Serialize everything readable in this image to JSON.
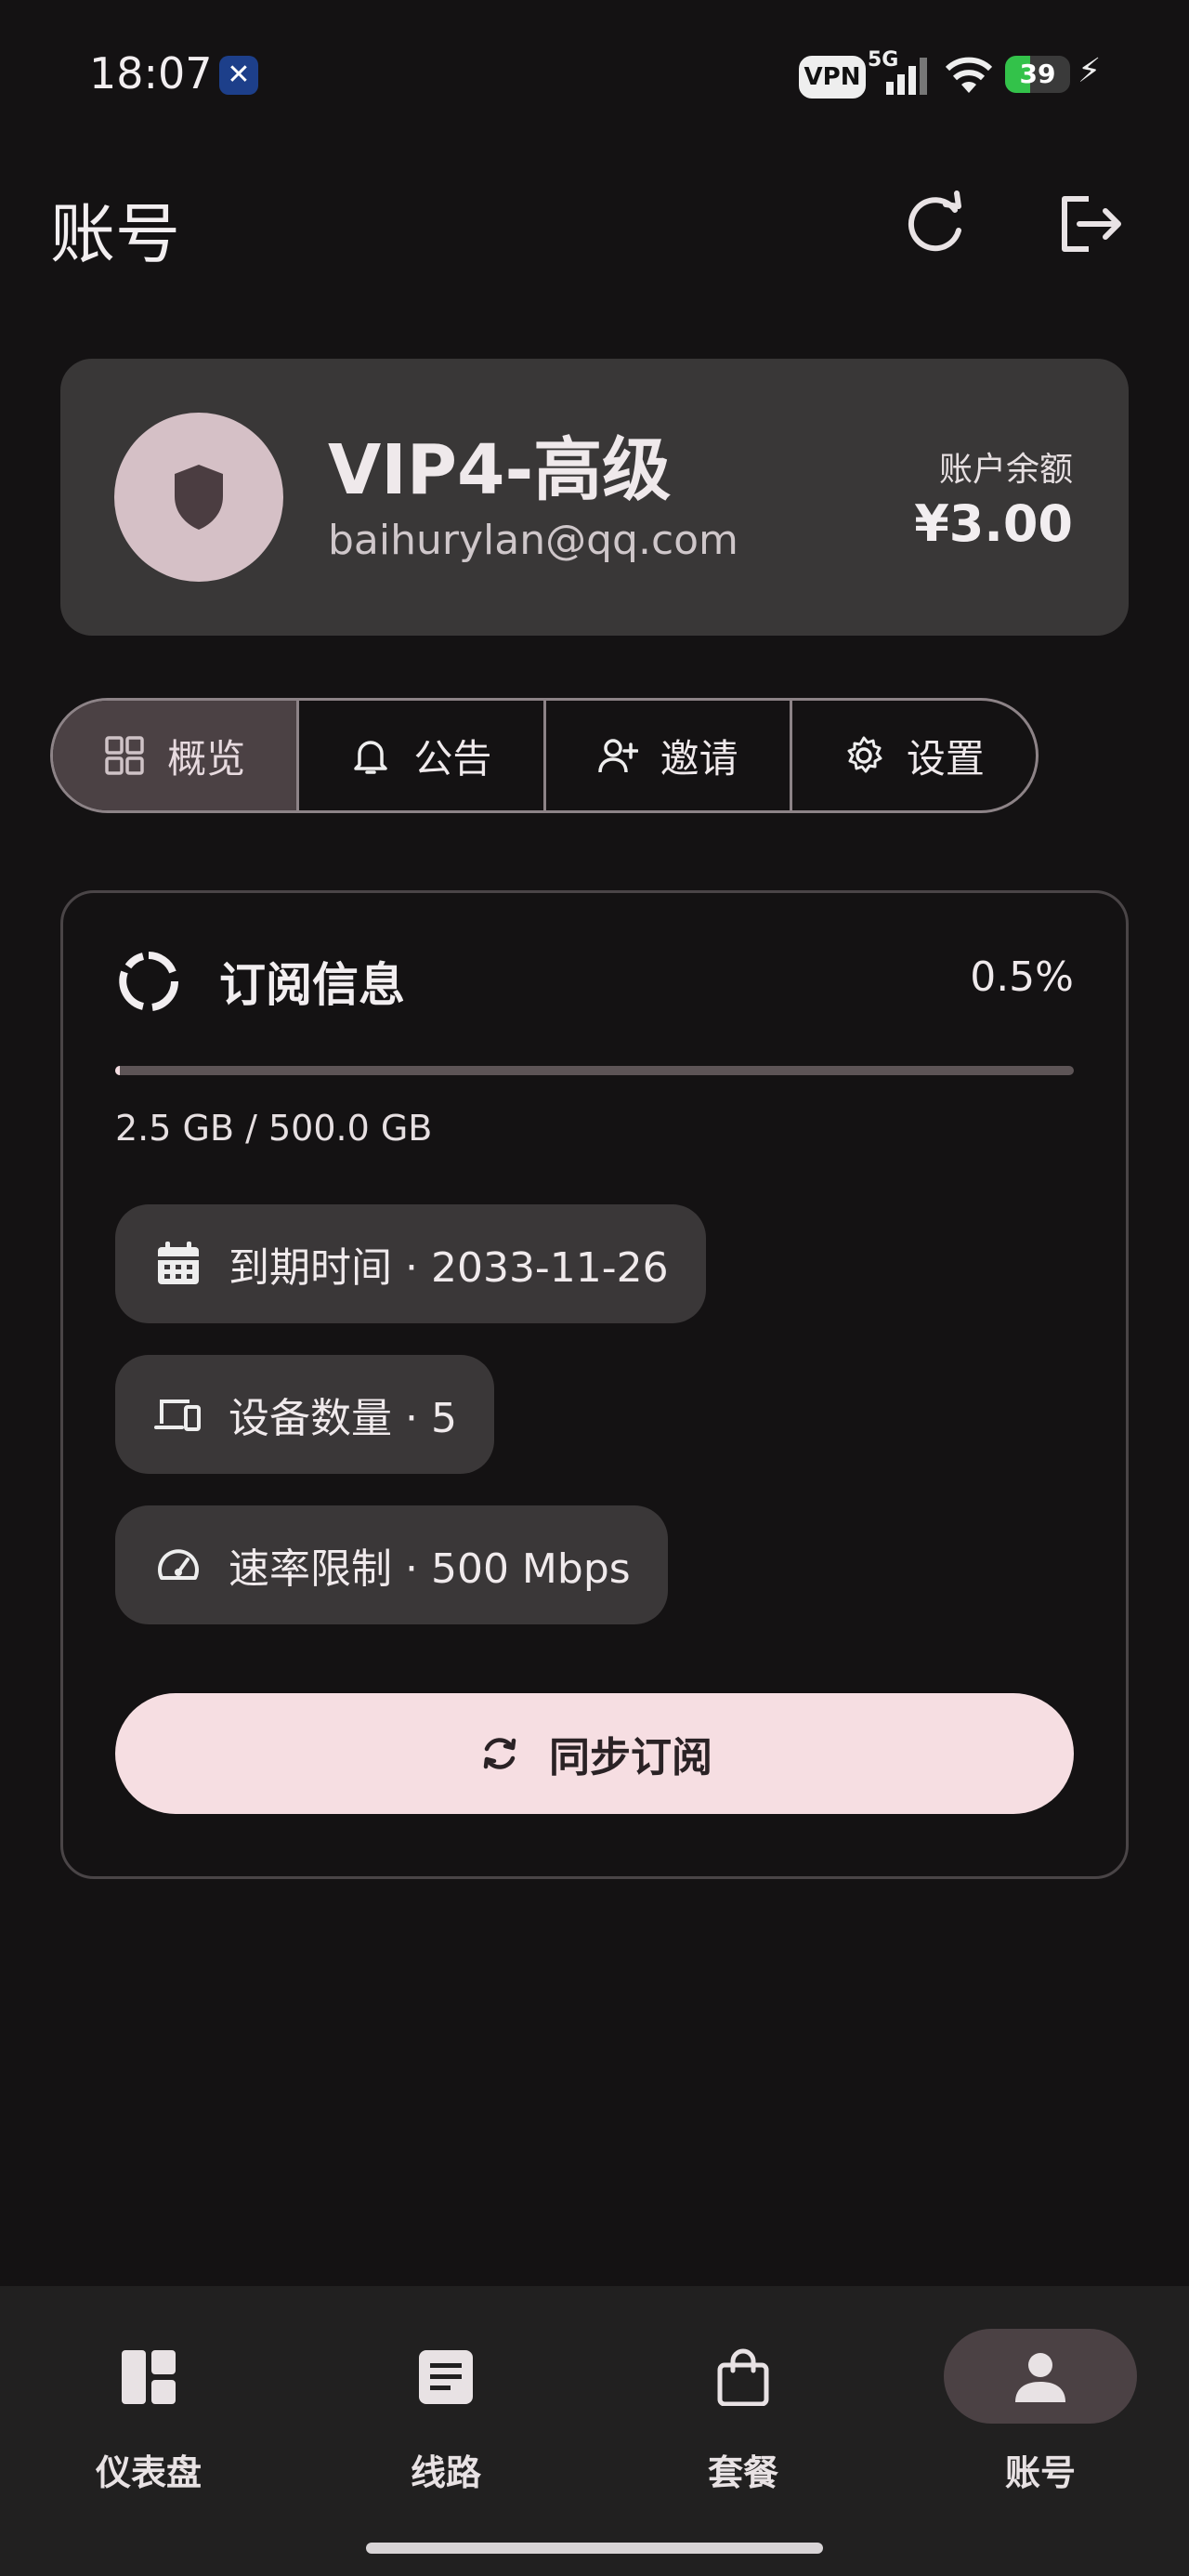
{
  "status_bar": {
    "time": "18:07",
    "x_badge": "✕",
    "vpn": "VPN",
    "network": "5G",
    "battery_percent": 39,
    "battery_label": "39"
  },
  "header": {
    "title": "账号",
    "refresh_icon": "refresh-icon",
    "logout_icon": "logout-icon"
  },
  "profile": {
    "plan": "VIP4-高级",
    "email": "baihurylan@qq.com",
    "balance_label": "账户余额",
    "balance_value": "¥3.00",
    "avatar_icon": "shield-icon"
  },
  "tabs": [
    {
      "label": "概览",
      "icon": "grid-icon",
      "active": true
    },
    {
      "label": "公告",
      "icon": "bell-icon",
      "active": false
    },
    {
      "label": "邀请",
      "icon": "person-add-icon",
      "active": false
    },
    {
      "label": "设置",
      "icon": "gear-icon",
      "active": false
    }
  ],
  "subscription": {
    "title": "订阅信息",
    "percent_label": "0.5%",
    "used_fraction": 0.005,
    "usage": "2.5 GB / 500.0 GB",
    "chips": [
      {
        "label": "到期时间 · 2033-11-26",
        "icon": "calendar-icon"
      },
      {
        "label": "设备数量 · 5",
        "icon": "devices-icon"
      },
      {
        "label": "速率限制 · 500 Mbps",
        "icon": "speedometer-icon"
      }
    ],
    "sync_button": "同步订阅"
  },
  "bottom_nav": [
    {
      "label": "仪表盘",
      "icon": "dashboard-icon",
      "active": false
    },
    {
      "label": "线路",
      "icon": "list-icon",
      "active": false
    },
    {
      "label": "套餐",
      "icon": "bag-icon",
      "active": false
    },
    {
      "label": "账号",
      "icon": "person-icon",
      "active": true
    }
  ],
  "colors": {
    "background": "#141213",
    "card": "#393737",
    "accent_pill": "#4b4144",
    "sync_button": "#f6dee2",
    "progress_fill": "#f4dde2"
  }
}
